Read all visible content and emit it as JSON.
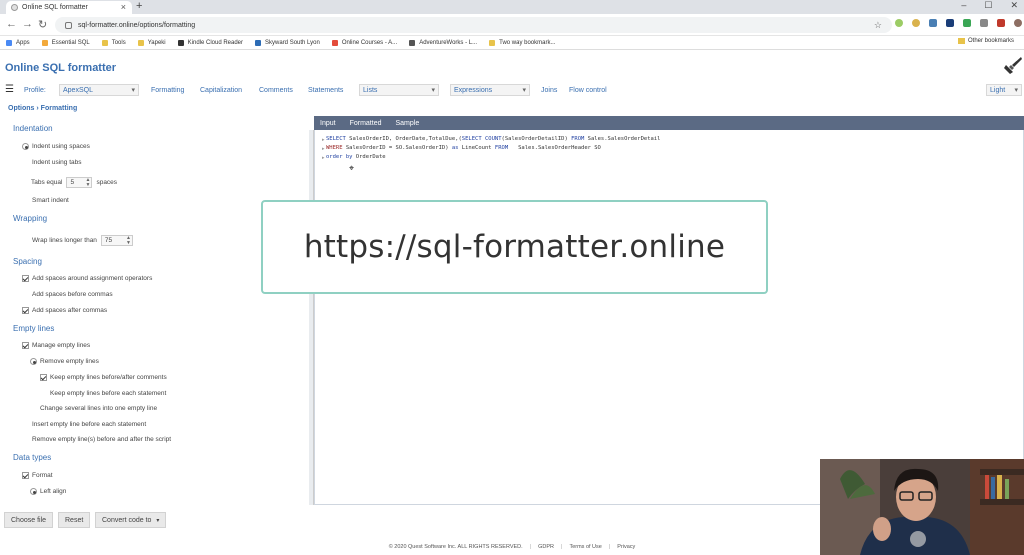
{
  "browser": {
    "tab_title": "Online SQL formatter",
    "new_tab_icon": "plus-icon",
    "url": "sql-formatter.online/options/formatting",
    "bookmarks": [
      {
        "label": "Apps",
        "color": "#4a8af4"
      },
      {
        "label": "Essential SQL",
        "color": "#f2a93b"
      },
      {
        "label": "Tools",
        "color": "#e8c34a"
      },
      {
        "label": "Yapeki",
        "color": "#e8c34a"
      },
      {
        "label": "Kindle Cloud Reader",
        "color": "#333333"
      },
      {
        "label": "Skyward South Lyon",
        "color": "#2d6cb5"
      },
      {
        "label": "Online Courses - A...",
        "color": "#e34c3b"
      },
      {
        "label": "AdventureWorks - L...",
        "color": "#555555"
      },
      {
        "label": "Two way bookmark...",
        "color": "#e8c34a"
      }
    ],
    "other_bookmarks": "Other bookmarks"
  },
  "app": {
    "title": "Online SQL formatter",
    "profile_label": "Profile:",
    "profile_value": "ApexSQL",
    "menu": [
      "Formatting",
      "Capitalization",
      "Comments",
      "Statements"
    ],
    "lists_select": "Lists",
    "expressions_select": "Expressions",
    "menu_after": [
      "Joins",
      "Flow control"
    ],
    "theme_select": "Light"
  },
  "options": {
    "breadcrumb": "Options › Formatting",
    "indentation": {
      "title": "Indentation",
      "indent_spaces": "Indent using spaces",
      "indent_tabs": "Indent using tabs",
      "tabs_equal": "Tabs equal",
      "tabs_value": "5",
      "spaces": "spaces",
      "smart_indent": "Smart indent"
    },
    "wrapping": {
      "title": "Wrapping",
      "wrap_label": "Wrap lines longer than",
      "wrap_value": "75"
    },
    "spacing": {
      "title": "Spacing",
      "around_assign": "Add spaces around assignment operators",
      "before_commas": "Add spaces before commas",
      "after_commas": "Add spaces after commas"
    },
    "empty_lines": {
      "title": "Empty lines",
      "manage": "Manage empty lines",
      "remove": "Remove empty lines",
      "keep_comments": "Keep empty lines before/after comments",
      "keep_statement": "Keep empty lines before each statement",
      "change_several": "Change several lines into one empty line",
      "insert_before": "Insert empty line before each statement",
      "remove_script": "Remove empty line(s) before and after the script"
    },
    "data_types": {
      "title": "Data types",
      "format": "Format",
      "left_align": "Left align"
    }
  },
  "editor": {
    "tabs": [
      "Input",
      "Formatted",
      "Sample"
    ],
    "lines": [
      [
        [
          "kw",
          "SELECT"
        ],
        [
          "t",
          " SalesOrderID, OrderDate,TotalDue,("
        ],
        [
          "kw",
          "SELECT"
        ],
        [
          "t",
          " "
        ],
        [
          "kw",
          "COUNT"
        ],
        [
          "t",
          "(SalesOrderDetailID) "
        ],
        [
          "kw",
          "FROM"
        ],
        [
          "t",
          " Sales.SalesOrderDetail"
        ]
      ],
      [
        [
          "kw2",
          "WHERE"
        ],
        [
          "t",
          " SalesOrderID = SO.SalesOrderID) "
        ],
        [
          "kw",
          "as"
        ],
        [
          "t",
          " LineCount "
        ],
        [
          "kw",
          "FROM"
        ],
        [
          "t",
          "   Sales.SalesOrderHeader SO"
        ]
      ],
      [
        [
          "kw",
          "order by"
        ],
        [
          "t",
          " OrderDate"
        ]
      ]
    ]
  },
  "overlay_url": "https://sql-formatter.online",
  "bottom": {
    "choose_file": "Choose file",
    "reset": "Reset",
    "convert": "Convert code to"
  },
  "footer": {
    "copyright": "© 2020 Quest Software Inc. ALL RIGHTS RESERVED.",
    "gdpr": "GDPR",
    "terms": "Terms of Use",
    "privacy": "Privacy"
  }
}
